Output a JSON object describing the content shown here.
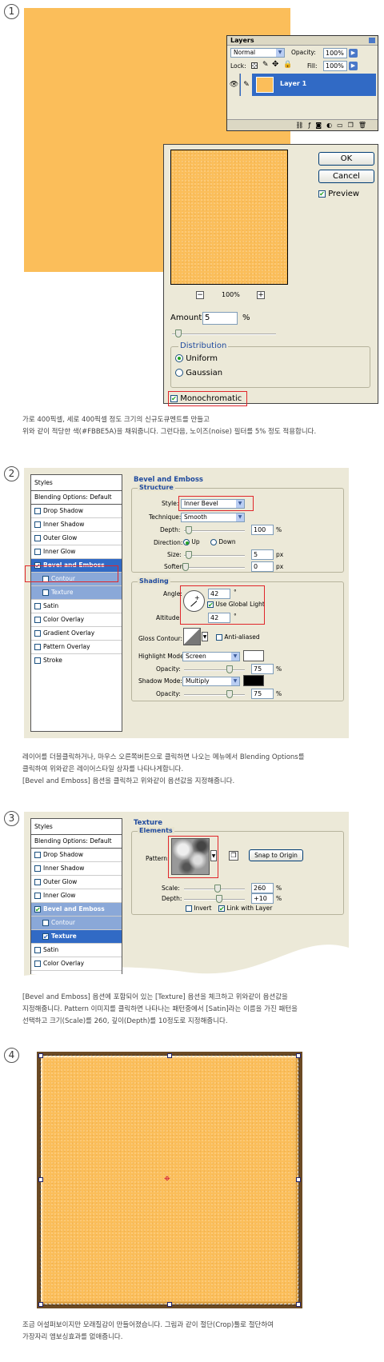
{
  "steps": [
    {
      "number": "1",
      "description": [
        "가로 400픽셀, 세로 400픽셀 정도 크기의 신규도큐멘트를 만들고",
        "위와 같이 적당한 색(#FBBE5A)을 채워줍니다. 그런다음, 노이즈(noise) 필터를 5% 정도 적용합니다."
      ]
    },
    {
      "number": "2",
      "description": [
        "레이어를 더블클릭하거나, 마우스 오른쪽버튼으로 클릭하면 나오는 메뉴에서 Blending Options를",
        "클릭하여 위와같은 레이어스타일 상자를 나타나게합니다.",
        "[Bevel and Emboss] 옵션을 클릭하고 위와같이 옵션값을 지정해줍니다."
      ]
    },
    {
      "number": "3",
      "description": [
        "[Bevel and Emboss] 옵션에 포함되어 있는 [Texture] 옵션을 체크하고 위와같이 옵션값을",
        "지정해줍니다. Pattern 이미지를 클릭하면 나타나는 패턴중에서 [Satin]라는 이름을 가진 패턴을",
        "선택하고 크기(Scale)를 260, 깊이(Depth)를 10정도로 지정해줍니다."
      ]
    },
    {
      "number": "4",
      "description": [
        "조금 어설퍼보이지만 모래질감이 만들어졌습니다. 그림과 같이 절단(Crop)툴로 절단하여",
        "가장자리 엠보싱효과를 없애줍니다."
      ]
    }
  ],
  "colors": {
    "fill": "#FBBE5A",
    "highlight": "#316ac5",
    "accent_red": "#e0262a"
  },
  "layers_panel": {
    "title": "Layers",
    "blend_mode": "Normal",
    "opacity_label": "Opacity:",
    "opacity_value": "100%",
    "lock_label": "Lock:",
    "fill_label": "Fill:",
    "fill_value": "100%",
    "layer_name": "Layer 1"
  },
  "noise_dialog": {
    "ok": "OK",
    "cancel": "Cancel",
    "preview": "Preview",
    "zoom": "100%",
    "amount_label": "Amount:",
    "amount_value": "5",
    "percent": "%",
    "distribution_title": "Distribution",
    "uniform": "Uniform",
    "gaussian": "Gaussian",
    "monochromatic": "Monochromatic",
    "amount_fraction": 0.05
  },
  "styles_list_2": {
    "header": "Styles",
    "items": [
      "Blending Options: Default",
      "Drop Shadow",
      "Inner Shadow",
      "Outer Glow",
      "Inner Glow",
      "Bevel and Emboss",
      "Contour",
      "Texture",
      "Satin",
      "Color Overlay",
      "Gradient Overlay",
      "Pattern Overlay",
      "Stroke"
    ]
  },
  "bevel": {
    "title": "Bevel and Emboss",
    "structure": "Structure",
    "style_label": "Style:",
    "style_value": "Inner Bevel",
    "technique_label": "Technique:",
    "technique_value": "Smooth",
    "depth_label": "Depth:",
    "depth_value": "100",
    "direction_label": "Direction:",
    "up": "Up",
    "down": "Down",
    "size_label": "Size:",
    "size_value": "5",
    "soften_label": "Soften:",
    "soften_value": "0",
    "px": "px",
    "percent": "%",
    "shading": "Shading",
    "angle_label": "Angle:",
    "angle_value": "42",
    "global_light": "Use Global Light",
    "altitude_label": "Altitude:",
    "altitude_value": "42",
    "deg": "°",
    "gloss_label": "Gloss Contour:",
    "anti_aliased": "Anti-aliased",
    "highlight_label": "Highlight Mode:",
    "highlight_value": "Screen",
    "opacity_label": "Opacity:",
    "highlight_opacity": "75",
    "shadow_label": "Shadow Mode:",
    "shadow_value": "Multiply",
    "shadow_opacity": "75"
  },
  "styles_list_3": {
    "header": "Styles",
    "items": [
      "Blending Options: Default",
      "Drop Shadow",
      "Inner Shadow",
      "Outer Glow",
      "Inner Glow",
      "Bevel and Emboss",
      "Contour",
      "Texture",
      "Satin",
      "Color Overlay"
    ]
  },
  "texture": {
    "title": "Texture",
    "elements": "Elements",
    "pattern_label": "Pattern:",
    "snap": "Snap to Origin",
    "scale_label": "Scale:",
    "scale_value": "260",
    "depth_label": "Depth:",
    "depth_value": "+10",
    "percent": "%",
    "invert": "Invert",
    "link": "Link with Layer"
  }
}
